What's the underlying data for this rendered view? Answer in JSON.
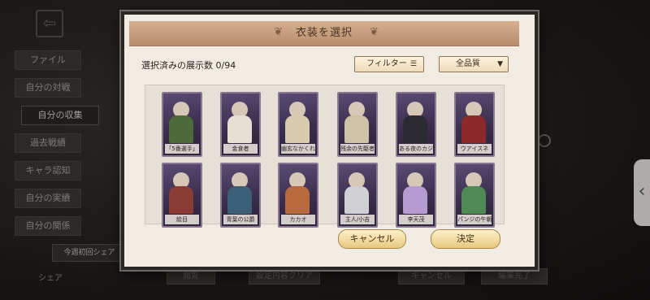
{
  "background": {
    "menu": [
      "ファイル",
      "自分の対戦",
      "自分の収集",
      "過去戦績",
      "キャラ認知",
      "自分の実績",
      "自分の関係"
    ],
    "active_index": 2,
    "share_banner": "今週初回シェア",
    "share_label": "シェア",
    "bottom_buttons": [
      "閲覧",
      "設定内容クリア",
      "キャンセル",
      "編集完了"
    ]
  },
  "modal": {
    "title": "衣装を選択",
    "count_label": "選択済みの展示数 0/94",
    "filter_label": "フィルター",
    "quality_label": "全品質",
    "cancel_label": "キャンセル",
    "ok_label": "決定",
    "costumes": [
      {
        "name": "「5番選手」",
        "color": "#4d6a3a"
      },
      {
        "name": "金食者",
        "color": "#e6e0d4"
      },
      {
        "name": "幽玄なかくれんぼ",
        "color": "#d8cbb0"
      },
      {
        "name": "残余の先駆者",
        "color": "#cfc2a6"
      },
      {
        "name": "ある夜のカジュアル",
        "color": "#2c2a33"
      },
      {
        "name": "ウアイスネ",
        "color": "#8c2a2a"
      },
      {
        "name": "絵目",
        "color": "#8a3b36"
      },
      {
        "name": "青葉の公爵",
        "color": "#3c5f78"
      },
      {
        "name": "カカオ",
        "color": "#b86a3c"
      },
      {
        "name": "主人/小吉",
        "color": "#cfcfd4"
      },
      {
        "name": "李天茂",
        "color": "#b69ad0"
      },
      {
        "name": "パンジの午朝",
        "color": "#4f8a55"
      }
    ]
  }
}
